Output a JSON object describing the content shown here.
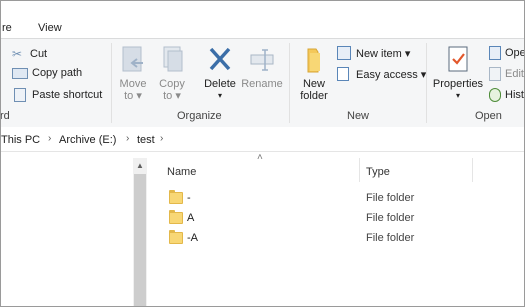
{
  "tabs": [
    "re",
    "View"
  ],
  "clipboard": {
    "cut": "Cut",
    "copy_path": "Copy path",
    "paste_shortcut": "Paste shortcut",
    "group_label": "rd"
  },
  "organize": {
    "move_to": [
      "Move",
      "to ▾"
    ],
    "copy_to": [
      "Copy",
      "to ▾"
    ],
    "delete": "Delete",
    "rename": "Rename",
    "group_label": "Organize"
  },
  "new": {
    "new_folder": [
      "New",
      "folder"
    ],
    "new_item": "New item ▾",
    "easy_access": "Easy access ▾",
    "group_label": "New"
  },
  "open": {
    "properties": "Properties",
    "open": "Ope",
    "edit": "Edit",
    "history": "Hist",
    "group_label": "Open"
  },
  "address": {
    "crumbs": [
      "This PC",
      "Archive (E:)",
      "test"
    ]
  },
  "list": {
    "columns": {
      "name": "Name",
      "type": "Type"
    },
    "rows": [
      {
        "name": "-",
        "type": "File folder"
      },
      {
        "name": "A",
        "type": "File folder"
      },
      {
        "name": "-A",
        "type": "File folder"
      }
    ]
  },
  "colors": {
    "folder": "#f8d775",
    "accent": "#2b79d0"
  }
}
